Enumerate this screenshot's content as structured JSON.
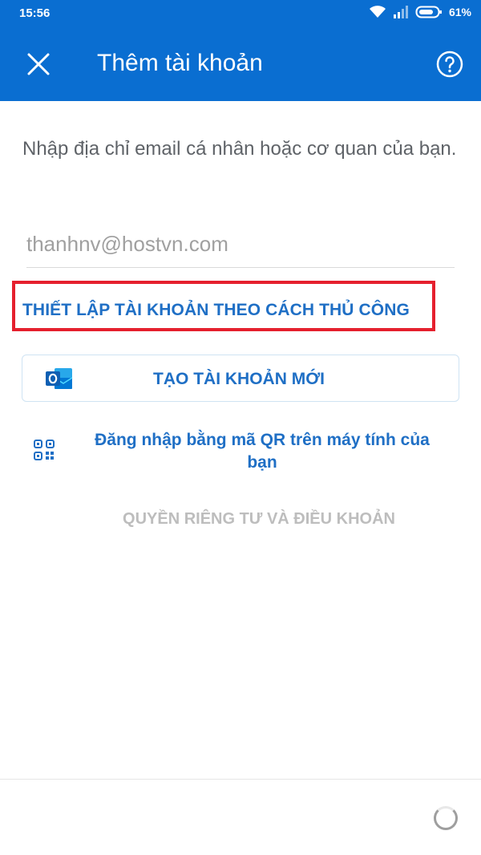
{
  "status_bar": {
    "time": "15:56",
    "battery_percent": "61%",
    "icons": [
      "wifi-icon",
      "signal-icon",
      "battery-icon"
    ]
  },
  "app_bar": {
    "title": "Thêm tài khoản",
    "close_icon": "close-icon",
    "help_icon": "help-icon",
    "background_color": "#0a6ed1"
  },
  "form": {
    "prompt": "Nhập địa chỉ email cá nhân hoặc cơ quan của bạn.",
    "email_placeholder": "thanhnv@hostvn.com"
  },
  "actions": {
    "manual_setup_label": "THIẾT LẬP TÀI KHOẢN THEO CÁCH THỦ CÔNG",
    "create_account_label": "TẠO TÀI KHOẢN MỚI",
    "qr_signin_label": "Đăng nhập bằng mã QR trên máy tính của bạn",
    "privacy_label": "QUYỀN RIÊNG TƯ VÀ ĐIỀU KHOẢN",
    "link_color": "#1f6fc5",
    "highlight_color": "#e5202e"
  }
}
